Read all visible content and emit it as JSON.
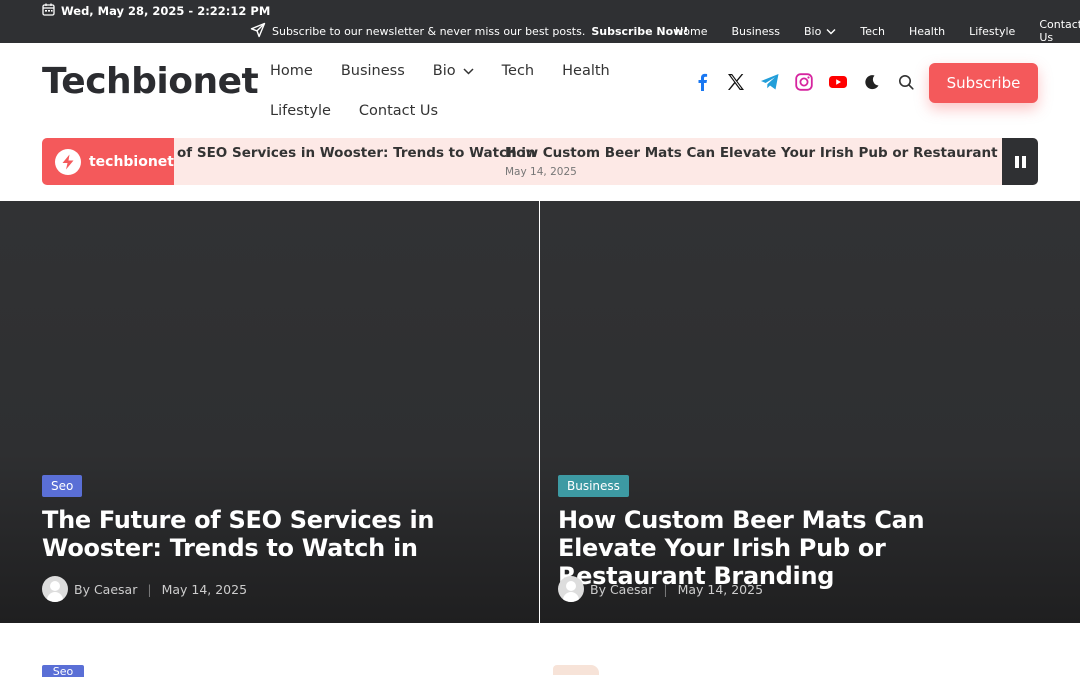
{
  "topbar": {
    "date": "Wed, May 28, 2025 - 2:22:12 PM",
    "newsletter_text": "Subscribe to our newsletter & never miss our best posts.",
    "newsletter_cta": "Subscribe Now!",
    "nav": [
      "Home",
      "Business",
      "Bio",
      "Tech",
      "Health",
      "Lifestyle",
      "Contact Us"
    ]
  },
  "header": {
    "logo": "Techbionet",
    "nav_row1": [
      "Home",
      "Business",
      "Bio",
      "Tech",
      "Health"
    ],
    "nav_row2": [
      "Lifestyle",
      "Contact Us"
    ],
    "social_icons": [
      "facebook-icon",
      "x-icon",
      "telegram-icon",
      "instagram-icon",
      "youtube-icon"
    ],
    "subscribe_label": "Subscribe",
    "colors": {
      "accent": "#f4595b",
      "dark": "#2f3033"
    }
  },
  "ticker": {
    "brand": "techbionet",
    "item1": "of SEO Services in Wooster: Trends to Watch in",
    "item2": "How Custom Beer Mats Can Elevate Your Irish Pub or Restaurant Branding",
    "item2_date": "May 14, 2025"
  },
  "posts": [
    {
      "category": "Seo",
      "category_color": "#5a6fd6",
      "title": "The Future of SEO Services in Wooster: Trends to Watch in",
      "author": "By Caesar",
      "date": "May 14, 2025"
    },
    {
      "category": "Business",
      "category_color": "#3d9aa3",
      "title": "How Custom Beer Mats Can Elevate Your Irish Pub or Restaurant Branding",
      "author": "By Caesar",
      "date": "May 14, 2025"
    }
  ],
  "below": {
    "category": "Seo"
  }
}
